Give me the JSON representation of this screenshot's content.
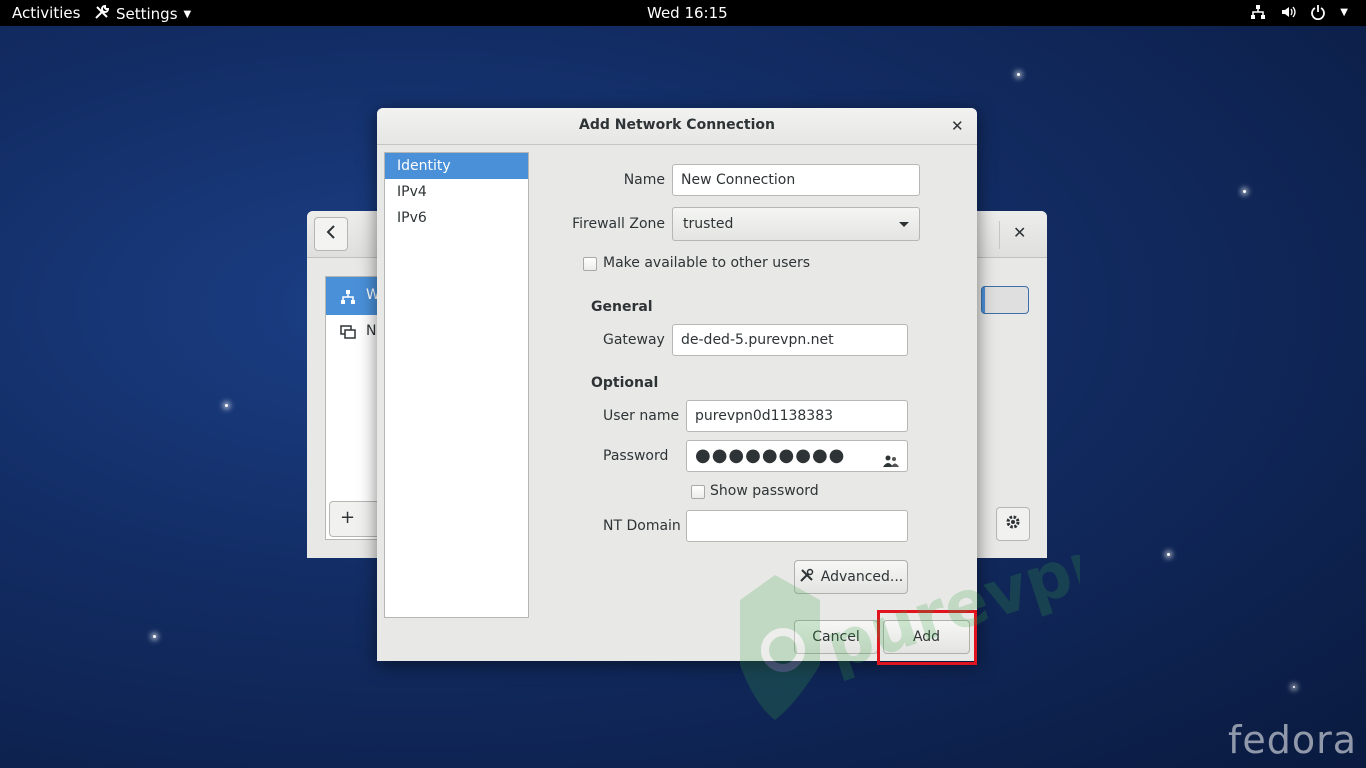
{
  "topbar": {
    "activities": "Activities",
    "app_menu": "Settings",
    "clock": "Wed 16:15"
  },
  "dialog": {
    "title": "Add Network Connection",
    "sidebar": [
      "Identity",
      "IPv4",
      "IPv6"
    ],
    "name_label": "Name",
    "name_value": "New Connection",
    "firewall_label": "Firewall Zone",
    "firewall_value": "trusted",
    "make_available_label": "Make available to other users",
    "general_heading": "General",
    "gateway_label": "Gateway",
    "gateway_value": "de-ded-5.purevpn.net",
    "optional_heading": "Optional",
    "username_label": "User name",
    "username_value": "purevpn0d1138383",
    "password_label": "Password",
    "password_value": "●●●●●●●●●",
    "show_password_label": "Show password",
    "nt_domain_label": "NT Domain",
    "nt_domain_value": "",
    "advanced_button": "Advanced...",
    "cancel_button": "Cancel",
    "add_button": "Add"
  },
  "background_window": {
    "list_item_1": "W",
    "list_item_2": "N"
  },
  "branding": {
    "watermark": "purevpn",
    "distro": "fedora"
  },
  "colors": {
    "accent": "#4a90d9",
    "highlight_box": "#e0141f"
  }
}
